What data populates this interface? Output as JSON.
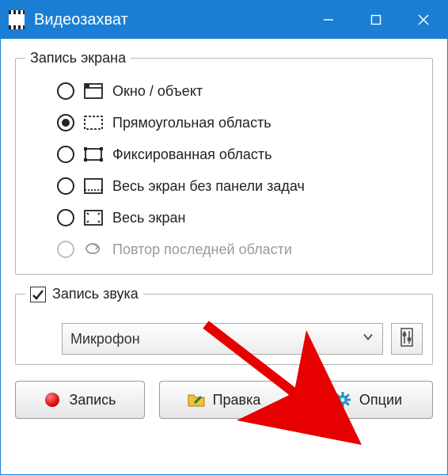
{
  "window": {
    "title": "Видеозахват"
  },
  "screen_group_label": "Запись экрана",
  "modes": {
    "window": {
      "label": "Окно / объект"
    },
    "rect": {
      "label": "Прямоугольная область"
    },
    "fixed": {
      "label": "Фиксированная область"
    },
    "notask": {
      "label": "Весь экран без панели задач"
    },
    "full": {
      "label": "Весь экран"
    },
    "repeat": {
      "label": "Повтор последней области"
    }
  },
  "audio": {
    "group_label": "Запись звука",
    "selected_device": "Микрофон"
  },
  "buttons": {
    "record": "Запись",
    "edit": "Правка",
    "options": "Опции"
  }
}
